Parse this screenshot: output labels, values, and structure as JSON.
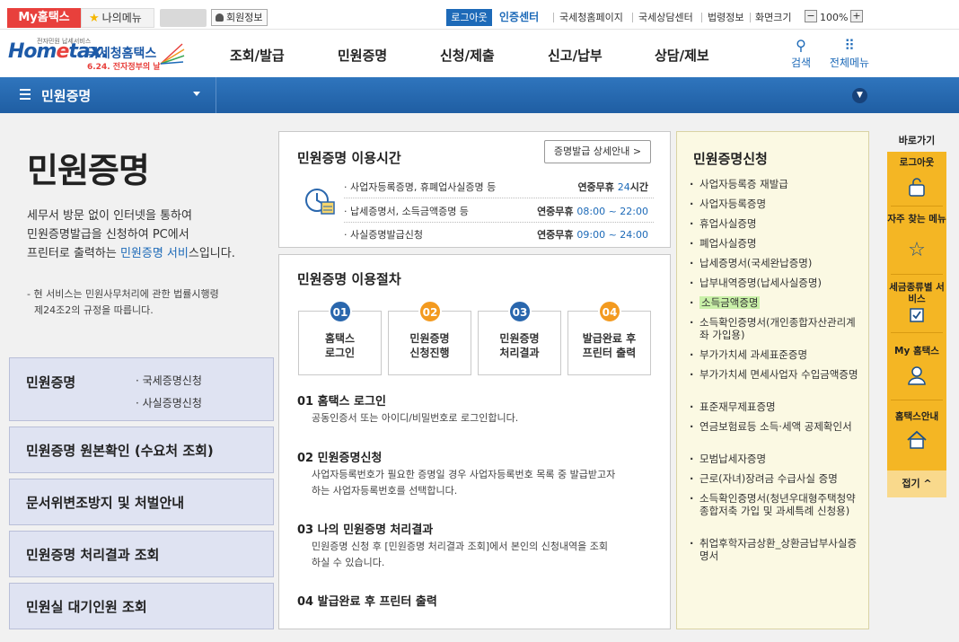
{
  "topbar": {
    "my_hometax": "My홈택스",
    "my_menu": "나의메뉴",
    "member_info": "회원정보",
    "logout": "로그아웃",
    "cert_center": "인증센터",
    "links": [
      "국세청홈페이지",
      "국세상담센터",
      "법령정보",
      "화면크기"
    ],
    "zoom_minus": "−",
    "zoom_level": "100%",
    "zoom_plus": "+"
  },
  "header": {
    "logo_small": "전자민원 납세서비스",
    "logo_word_a": "Hom",
    "logo_word_e": "e",
    "logo_word_b": "tax.",
    "logo_kr": "국세청홈택스",
    "logo_sub": "6.24. 전자정부의 날",
    "gnb": [
      "조회/발급",
      "민원증명",
      "신청/제출",
      "신고/납부",
      "상담/제보"
    ],
    "search": "검색",
    "all_menu": "전체메뉴"
  },
  "navbar": {
    "title": "민원증명"
  },
  "left": {
    "page_title": "민원증명",
    "intro_line1": "세무서 방문 없이 인터넷을 통하여",
    "intro_line2": "민원증명발급을 신청하여 PC에서",
    "intro_line3a": "프린터로 출력하는 ",
    "intro_line3b": "민원증명 서비",
    "intro_line3c": "스입니다.",
    "legal_note_1": "- 현 서비스는 민원사무처리에 관한 법률시행령",
    "legal_note_2": "제24조2의 규정을 따릅니다.",
    "menu": [
      {
        "label": "민원증명",
        "subs": [
          "국세증명신청",
          "사실증명신청"
        ]
      },
      {
        "label": "민원증명 원본확인 (수요처 조회)"
      },
      {
        "label": "문서위변조방지 및 처벌안내"
      },
      {
        "label": "민원증명 처리결과 조회"
      },
      {
        "label": "민원실 대기인원 조회"
      }
    ]
  },
  "hours": {
    "title": "민원증명 이용시간",
    "detail_button": "증명발급 상세안내 >",
    "rows": [
      {
        "name": "사업자등록증명, 휴폐업사실증명 등",
        "time_prefix": "연중무휴 ",
        "time_value": "24",
        "time_suffix": "시간"
      },
      {
        "name": "납세증명서, 소득금액증명 등",
        "time_prefix": "연중무휴 ",
        "time_value": "08:00 ~ 22:00",
        "time_suffix": ""
      },
      {
        "name": "사실증명발급신청",
        "time_prefix": "연중무휴 ",
        "time_value": "09:00 ~ 24:00",
        "time_suffix": ""
      }
    ]
  },
  "procedure": {
    "title": "민원증명 이용절차",
    "steps": [
      {
        "num": "01",
        "line1": "홈택스",
        "line2": "로그인",
        "color": "#2a67ad"
      },
      {
        "num": "02",
        "line1": "민원증명",
        "line2": "신청진행",
        "color": "#f39a1f"
      },
      {
        "num": "03",
        "line1": "민원증명",
        "line2": "처리결과",
        "color": "#2a67ad"
      },
      {
        "num": "04",
        "line1": "발급완료 후",
        "line2": "프린터 출력",
        "color": "#f39a1f"
      }
    ],
    "details": [
      {
        "heading": "01 홈택스 로그인",
        "line1": "공동인증서 또는 아이디/비밀번호로 로그인합니다.",
        "line2": ""
      },
      {
        "heading": "02 민원증명신청",
        "line1": "사업자등록번호가 필요한 증명일 경우 사업자등록번호 목록 중 발급받고자",
        "line2": "하는 사업자등록번호를 선택합니다."
      },
      {
        "heading": "03 나의 민원증명 처리결과",
        "line1": "민원증명 신청 후 [민원증명 처리결과 조회]에서 본인의 신청내역을 조회",
        "line2": "하실 수 있습니다."
      },
      {
        "heading": "04 발급완료 후 프린터 출력",
        "line1": "",
        "line2": ""
      }
    ]
  },
  "apply": {
    "title": "민원증명신청",
    "items": [
      "사업자등록증 재발급",
      "사업자등록증명",
      "휴업사실증명",
      "폐업사실증명",
      "납세증명서(국세완납증명)",
      "납부내역증명(납세사실증명)",
      "소득금액증명",
      "소득확인증명서(개인종합자산관리계좌 가입용)",
      "부가가치세 과세표준증명",
      "부가가치세 면세사업자 수입금액증명",
      "표준재무제표증명",
      "연금보험료등 소득·세액 공제확인서",
      "모범납세자증명",
      "근로(자녀)장려금 수급사실 증명",
      "소득확인증명서(청년우대형주택청약종합저축 가입 및 과세특례 신청용)",
      "취업후학자금상환_상환금납부사실증명서"
    ],
    "highlighted_index": 6
  },
  "quick": {
    "label": "바로가기",
    "items": [
      {
        "label": "로그아웃",
        "icon": "lock-icon"
      },
      {
        "label": "자주 찾는 메뉴",
        "icon": "star-icon"
      },
      {
        "label": "세금종류별 서비스",
        "icon": "checkbox-icon"
      },
      {
        "label": "My 홈택스",
        "icon": "person-icon"
      },
      {
        "label": "홈택스안내",
        "icon": "house-icon"
      }
    ],
    "fold": "접기 ^"
  },
  "colors": {
    "brand_blue": "#1d6ab8",
    "nav_blue": "#2f75bd",
    "my_red": "#e8403c",
    "quick_yellow": "#f4b624",
    "apply_bg": "#fbf9e3",
    "side_box": "#dfe3f2",
    "highlight": "#c9f0a8"
  }
}
